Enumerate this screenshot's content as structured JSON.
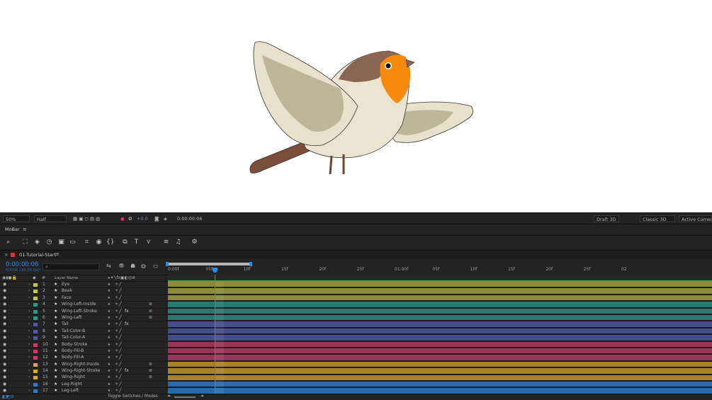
{
  "viewer": {
    "zoom": "50%",
    "resolution": "Half",
    "exposure": "+0.0",
    "timecode": "0:00:00:06",
    "renderer": "Draft 3D",
    "renderer_mode": "Classic 3D",
    "camera": "Active Camer..."
  },
  "panel": {
    "title": "MoBar"
  },
  "timeline": {
    "comp_tab": "01-Tutorial-Start",
    "current_time": "0:00:00:06",
    "frame_info": "00006 (30.00 fps)",
    "search_placeholder": "",
    "column_hash": "#",
    "column_layer_name": "Layer Name",
    "ruler_labels": [
      "0:00f",
      "05f",
      "10f",
      "15f",
      "20f",
      "25f",
      "01:00f",
      "05f",
      "10f",
      "15f",
      "20f",
      "25f",
      "02"
    ],
    "playhead_frame": 6,
    "visible_frames": 72,
    "layers": [
      {
        "num": "1",
        "name": "Eye",
        "label_color": "#c8c83c",
        "bar_color": "#8b8a3c",
        "fx": false,
        "parent_link": false
      },
      {
        "num": "2",
        "name": "Beak",
        "label_color": "#c8c83c",
        "bar_color": "#8b8a3c",
        "fx": false,
        "parent_link": false
      },
      {
        "num": "3",
        "name": "Face",
        "label_color": "#c8c83c",
        "bar_color": "#8b8a3c",
        "fx": false,
        "parent_link": false
      },
      {
        "num": "4",
        "name": "Wing-Left-Inside",
        "label_color": "#2e9a8e",
        "bar_color": "#267a70",
        "fx": false,
        "parent_link": true
      },
      {
        "num": "5",
        "name": "Wing-Left-Stroke",
        "label_color": "#2e9a8e",
        "bar_color": "#267a70",
        "fx": true,
        "parent_link": true
      },
      {
        "num": "6",
        "name": "Wing-Left",
        "label_color": "#2e9a8e",
        "bar_color": "#267a70",
        "fx": false,
        "parent_link": true
      },
      {
        "num": "7",
        "name": "Tail",
        "label_color": "#5058b8",
        "bar_color": "#454c8c",
        "fx": true,
        "parent_link": false
      },
      {
        "num": "8",
        "name": "Tail-Color-B",
        "label_color": "#5058b8",
        "bar_color": "#454c8c",
        "fx": false,
        "parent_link": false
      },
      {
        "num": "9",
        "name": "Tail-Color-A",
        "label_color": "#5058b8",
        "bar_color": "#454c8c",
        "fx": false,
        "parent_link": false
      },
      {
        "num": "10",
        "name": "Body-Stroke",
        "label_color": "#d23a6e",
        "bar_color": "#9c3456",
        "fx": false,
        "parent_link": false
      },
      {
        "num": "11",
        "name": "Body-Fill-B",
        "label_color": "#d23a6e",
        "bar_color": "#9c3456",
        "fx": false,
        "parent_link": false
      },
      {
        "num": "12",
        "name": "Body-Fill-A",
        "label_color": "#d23a6e",
        "bar_color": "#9c3456",
        "fx": false,
        "parent_link": false
      },
      {
        "num": "13",
        "name": "Wing-Right-Inside",
        "label_color": "#e0a820",
        "bar_color": "#a8822a",
        "fx": false,
        "parent_link": true
      },
      {
        "num": "14",
        "name": "Wing-Right-Stroke",
        "label_color": "#e0a820",
        "bar_color": "#a8822a",
        "fx": true,
        "parent_link": true
      },
      {
        "num": "15",
        "name": "Wing-Right",
        "label_color": "#e0a820",
        "bar_color": "#a8822a",
        "fx": false,
        "parent_link": true
      },
      {
        "num": "16",
        "name": "Leg-Right",
        "label_color": "#2a7fd0",
        "bar_color": "#2a6aaa",
        "fx": false,
        "parent_link": false
      },
      {
        "num": "17",
        "name": "Leg-Left",
        "label_color": "#2a7fd0",
        "bar_color": "#2a6aaa",
        "fx": false,
        "parent_link": false
      }
    ]
  },
  "status": {
    "toggle_label": "Toggle Switches / Modes"
  },
  "colors": {
    "accent": "#2d8ceb",
    "work_area": "#b7b7b7",
    "panel_bg": "#232323",
    "dark_bg": "#1d1d1d"
  },
  "icons": [
    "magnify-icon",
    "search-icon",
    "eye-icon",
    "lock-icon",
    "star-icon",
    "fx-icon",
    "camera-icon",
    "settings-icon",
    "graph-icon",
    "snapshot-icon"
  ]
}
